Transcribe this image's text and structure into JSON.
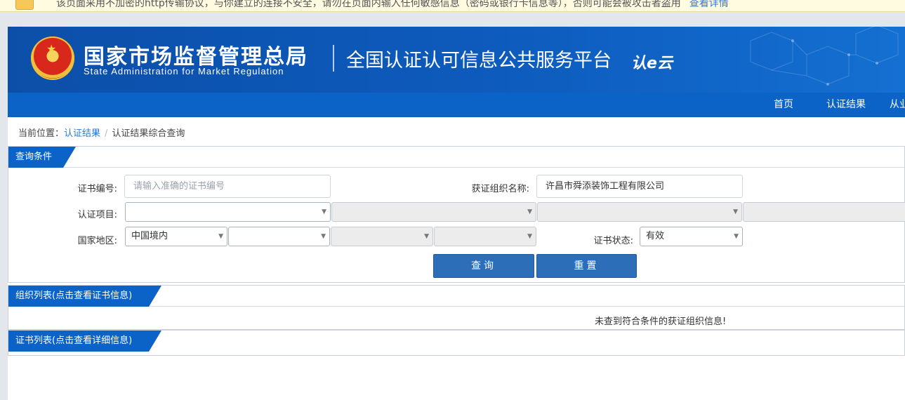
{
  "warning_bar": {
    "text": "该页面采用不加密的http传输协议，与你建立的连接不安全，请勿在页面内输入任何敏感信息（密码或银行卡信息等），否则可能会被攻击者盗用",
    "link": "查看详情"
  },
  "banner": {
    "agency_cn": "国家市场监督管理总局",
    "agency_en": "State Administration  for  Market Regulation",
    "platform_title": "全国认证认可信息公共服务平台",
    "platform_logo": "认e云"
  },
  "nav": {
    "items": [
      "首页",
      "认证结果",
      "从业"
    ]
  },
  "breadcrumb": {
    "prefix": "当前位置：",
    "link": "认证结果",
    "separator": "/",
    "current": "认证结果综合查询"
  },
  "query_panel": {
    "title": "查询条件",
    "cert_no": {
      "label": "证书编号:",
      "placeholder": "请输入准确的证书编号"
    },
    "org_name": {
      "label": "获证组织名称:",
      "value": "许昌市舜添装饰工程有限公司"
    },
    "project": {
      "label": "认证项目:",
      "values": [
        "",
        "",
        "",
        ""
      ]
    },
    "region": {
      "label": "国家地区:",
      "values": [
        "中国境内",
        "",
        "",
        ""
      ]
    },
    "status": {
      "label": "证书状态:",
      "value": "有效"
    },
    "search_button": "查询",
    "reset_button": "重置"
  },
  "org_list": {
    "title": "组织列表(点击查看证书信息)",
    "empty_message": "未查到符合条件的获证组织信息!"
  },
  "cert_list": {
    "title": "证书列表(点击查看详细信息)"
  },
  "colors": {
    "primary": "#0b62c7",
    "banner": "#0d5bbd",
    "button": "#2d6eb8",
    "link": "#2a7ad2"
  }
}
